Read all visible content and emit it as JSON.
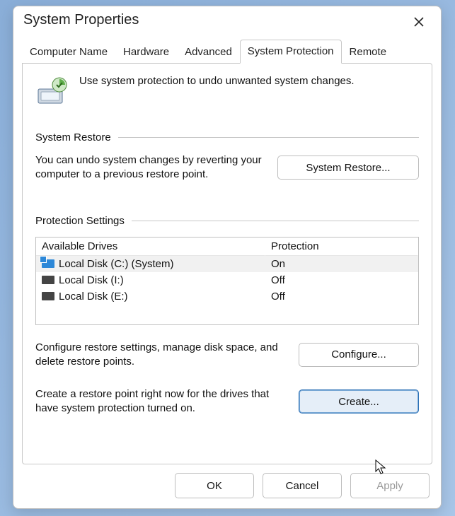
{
  "window": {
    "title": "System Properties"
  },
  "tabs": [
    {
      "label": "Computer Name"
    },
    {
      "label": "Hardware"
    },
    {
      "label": "Advanced"
    },
    {
      "label": "System Protection"
    },
    {
      "label": "Remote"
    }
  ],
  "intro_text": "Use system protection to undo unwanted system changes.",
  "restore": {
    "section_label": "System Restore",
    "desc": "You can undo system changes by reverting your computer to a previous restore point.",
    "button": "System Restore..."
  },
  "protection": {
    "section_label": "Protection Settings",
    "headers": {
      "drives": "Available Drives",
      "protection": "Protection"
    },
    "rows": [
      {
        "name": "Local Disk (C:) (System)",
        "status": "On"
      },
      {
        "name": "Local Disk (I:)",
        "status": "Off"
      },
      {
        "name": "Local Disk (E:)",
        "status": "Off"
      }
    ],
    "configure_desc": "Configure restore settings, manage disk space, and delete restore points.",
    "configure_button": "Configure...",
    "create_desc": "Create a restore point right now for the drives that have system protection turned on.",
    "create_button": "Create..."
  },
  "footer": {
    "ok": "OK",
    "cancel": "Cancel",
    "apply": "Apply"
  }
}
